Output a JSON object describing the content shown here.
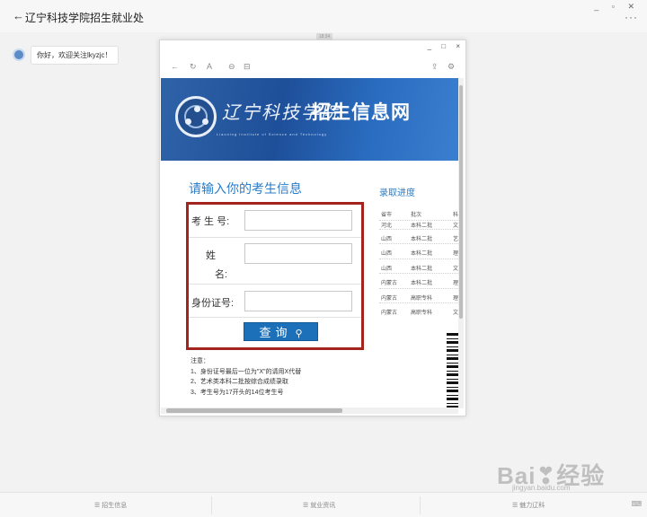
{
  "app": {
    "back_icon": "←",
    "title": "辽宁科技学院招生就业处",
    "window_controls": "_ ▫ ✕",
    "more_icon": "···"
  },
  "chat": {
    "message": "你好，欢迎关注lkyzjc！",
    "time_tag": "18:34"
  },
  "browser": {
    "window_controls": [
      "_",
      "□",
      "×"
    ],
    "toolbar": {
      "back": "←",
      "refresh": "↻",
      "font": "A",
      "link": "⊖",
      "copy": "⊟",
      "share": "⇪",
      "settings": "⚙"
    }
  },
  "banner": {
    "school_name": "辽宁科技学院",
    "site_name": "招生信息网",
    "english_name": "Liaoning Institute of Science and Technology"
  },
  "form": {
    "heading": "请输入你的考生信息",
    "exam_no_label": "考 生 号:",
    "name_label_1": "姓",
    "name_label_2": "名:",
    "id_label": "身份证号:",
    "query_button": "查询",
    "query_icon": "⚲"
  },
  "notes": {
    "title": "注意：",
    "items": [
      "1、身份证号最后一位为\"X\"的请用X代替",
      "2、艺术类本科二批按综合成绩录取",
      "3、考生号为17开头的14位考生号"
    ]
  },
  "progress": {
    "title": "录取进度",
    "headers": [
      "省市",
      "批次",
      "科"
    ],
    "rows": [
      [
        "河北",
        "本科二批",
        "文"
      ],
      [
        "山西",
        "本科二批",
        "艺"
      ],
      [
        "山西",
        "本科二批",
        "理"
      ],
      [
        "山西",
        "本科二批",
        "文"
      ],
      [
        "内蒙古",
        "本科二批",
        "理"
      ],
      [
        "内蒙古",
        "高职专科",
        "理"
      ],
      [
        "内蒙古",
        "高职专科",
        "文"
      ]
    ]
  },
  "bottom_menu": {
    "items": [
      "☰ 招生信息",
      "☰ 就业资讯",
      "☰ 魅力辽科"
    ],
    "keyboard": "⌨"
  },
  "watermark": {
    "main": "Bai❣经验",
    "sub": "jingyan.baidu.com"
  }
}
